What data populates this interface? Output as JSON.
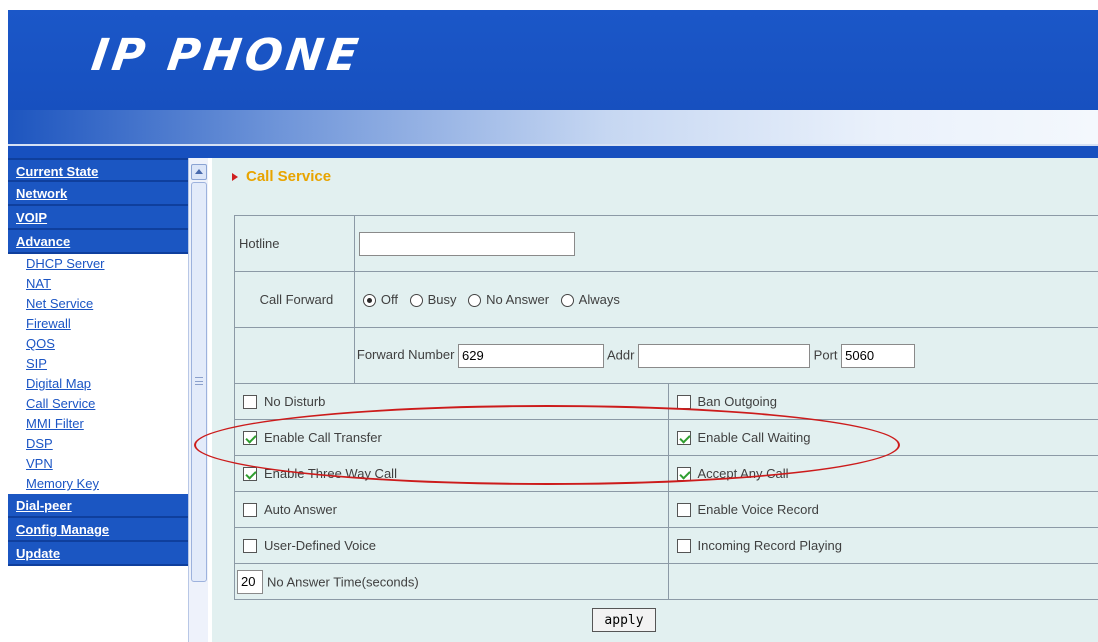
{
  "header": {
    "logo": "IP PHONE"
  },
  "sidebar": {
    "items": [
      {
        "label": "Current State",
        "type": "main"
      },
      {
        "label": "Network",
        "type": "main"
      },
      {
        "label": "VOIP",
        "type": "main"
      },
      {
        "label": "Advance",
        "type": "main"
      },
      {
        "label": "DHCP Server",
        "type": "sub"
      },
      {
        "label": "NAT",
        "type": "sub"
      },
      {
        "label": "Net Service",
        "type": "sub"
      },
      {
        "label": "Firewall",
        "type": "sub"
      },
      {
        "label": "QOS",
        "type": "sub"
      },
      {
        "label": "SIP",
        "type": "sub"
      },
      {
        "label": "Digital Map",
        "type": "sub"
      },
      {
        "label": "Call Service",
        "type": "sub"
      },
      {
        "label": "MMI Filter",
        "type": "sub"
      },
      {
        "label": "DSP",
        "type": "sub"
      },
      {
        "label": "VPN",
        "type": "sub"
      },
      {
        "label": "Memory Key",
        "type": "sub"
      },
      {
        "label": "Dial-peer",
        "type": "main"
      },
      {
        "label": "Config Manage",
        "type": "main"
      },
      {
        "label": "Update",
        "type": "main"
      }
    ]
  },
  "main": {
    "title": "Call Service",
    "hotline": {
      "label": "Hotline",
      "value": ""
    },
    "call_forward": {
      "label": "Call Forward",
      "options": [
        {
          "label": "Off",
          "checked": true
        },
        {
          "label": "Busy",
          "checked": false
        },
        {
          "label": "No Answer",
          "checked": false
        },
        {
          "label": "Always",
          "checked": false
        }
      ]
    },
    "forward": {
      "number_label": "Forward Number",
      "number_value": "629",
      "addr_label": "Addr",
      "addr_value": "",
      "port_label": "Port",
      "port_value": "5060"
    },
    "options": [
      [
        {
          "label": "No Disturb",
          "checked": false
        },
        {
          "label": "Ban Outgoing",
          "checked": false
        }
      ],
      [
        {
          "label": "Enable Call Transfer",
          "checked": true
        },
        {
          "label": "Enable Call Waiting",
          "checked": true
        }
      ],
      [
        {
          "label": "Enable Three Way Call",
          "checked": true
        },
        {
          "label": "Accept Any Call",
          "checked": true
        }
      ],
      [
        {
          "label": "Auto Answer",
          "checked": false
        },
        {
          "label": "Enable Voice Record",
          "checked": false
        }
      ],
      [
        {
          "label": "User-Defined Voice",
          "checked": false
        },
        {
          "label": "Incoming Record Playing",
          "checked": false
        }
      ]
    ],
    "no_answer_time": {
      "value": "20",
      "label": "No Answer Time(seconds)"
    },
    "apply_label": "apply"
  }
}
